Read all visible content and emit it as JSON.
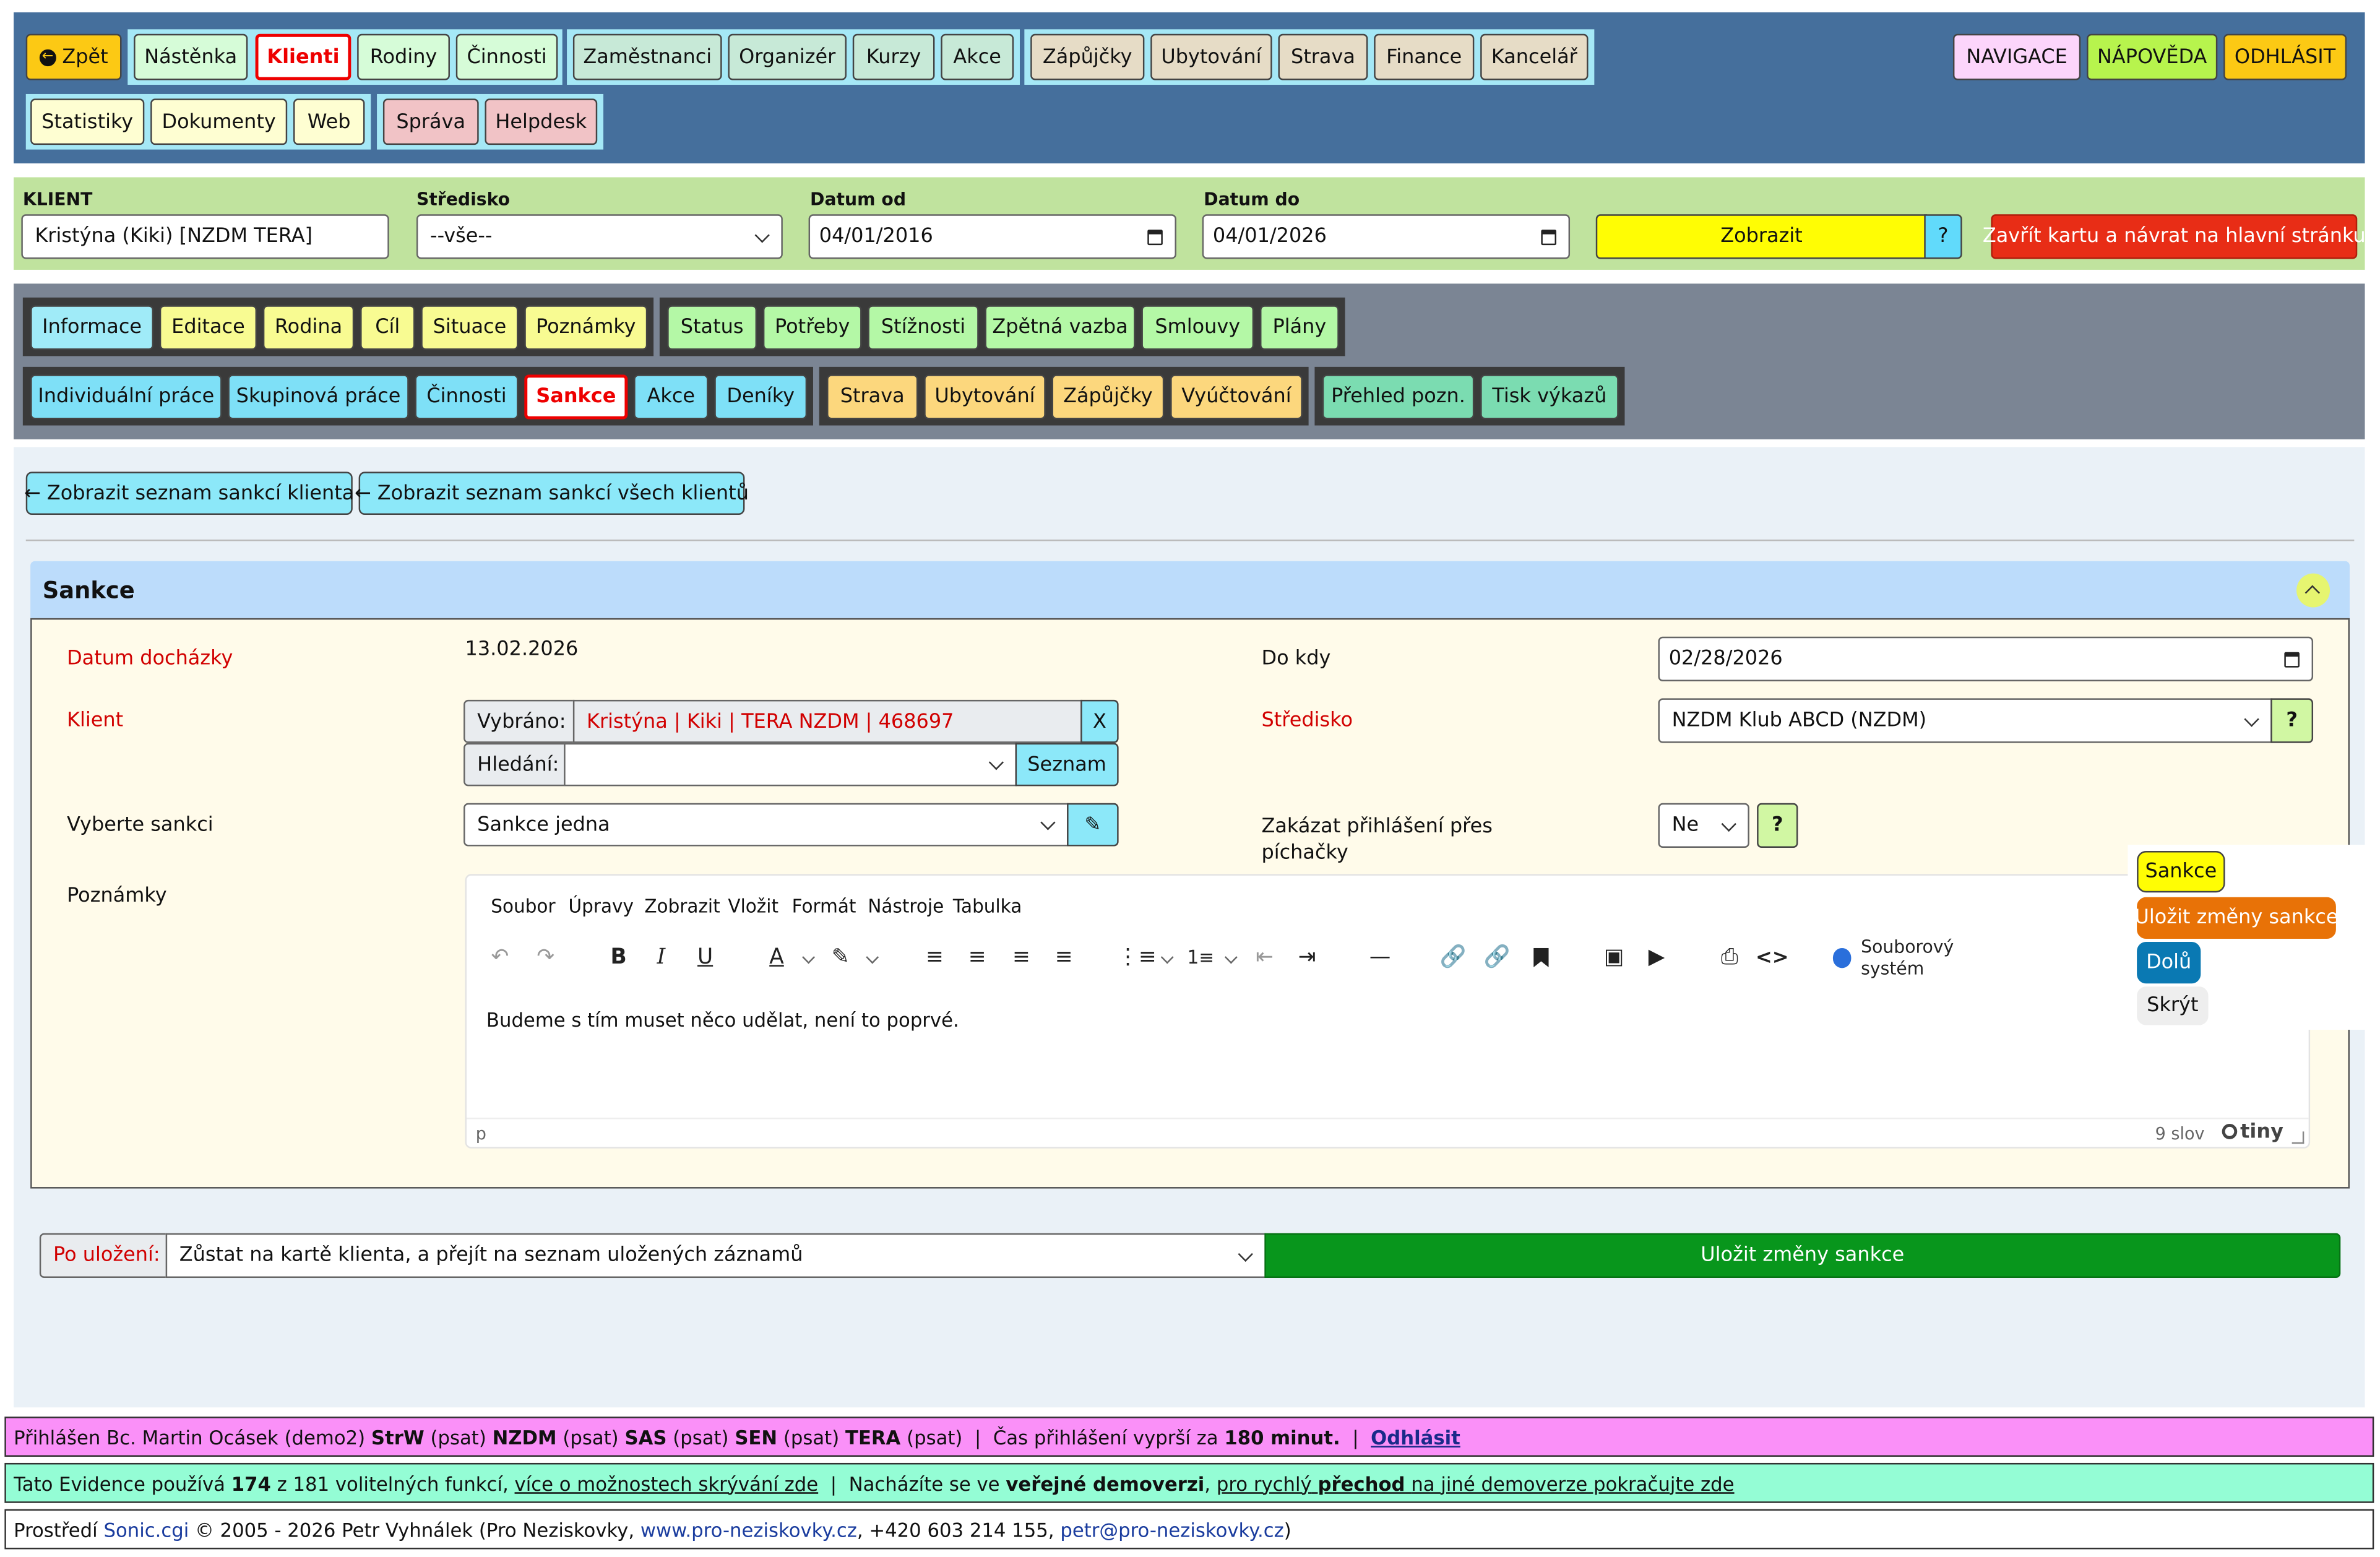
{
  "colors": {
    "topnav_bg": "#456f9c",
    "filter_bg": "#c0e39e",
    "tabs_bg": "#7b8594",
    "section_header": "#bcdcfb",
    "form_bg": "#fffbea",
    "save_green": "#08961c",
    "footer_user": "#fa90f8",
    "footer_info": "#94fdd5"
  },
  "topnav": {
    "back": "Zpět",
    "items": [
      "Nástěnka",
      "Klienti",
      "Rodiny",
      "Činnosti",
      "Zaměstnanci",
      "Organizér",
      "Kurzy",
      "Akce",
      "Zápůjčky",
      "Ubytování",
      "Strava",
      "Finance",
      "Kancelář",
      "Statistiky",
      "Dokumenty",
      "Web",
      "Správa",
      "Helpdesk"
    ],
    "right": [
      "NAVIGACE",
      "NÁPOVĚDA",
      "ODHLÁSIT"
    ]
  },
  "filter": {
    "klient_label": "KLIENT",
    "klient_value": "Kristýna (Kiki) [NZDM TERA]",
    "stredisko_label": "Středisko",
    "stredisko_value": "--vše--",
    "datum_od_label": "Datum od",
    "datum_od_value": "04/01/2016",
    "datum_do_label": "Datum do",
    "datum_do_value": "04/01/2026",
    "zobrazit": "Zobrazit",
    "help": "?",
    "zavrit": "Zavřít kartu a návrat na hlavní stránku"
  },
  "tabs": {
    "row1": [
      "Informace",
      "Editace",
      "Rodina",
      "Cíl",
      "Situace",
      "Poznámky",
      "Status",
      "Potřeby",
      "Stížnosti",
      "Zpětná vazba",
      "Smlouvy",
      "Plány"
    ],
    "row2": [
      "Individuální práce",
      "Skupinová práce",
      "Činnosti",
      "Sankce",
      "Akce",
      "Deníky",
      "Strava",
      "Ubytování",
      "Zápůjčky",
      "Vyúčtování",
      "Přehled pozn.",
      "Tisk výkazů"
    ]
  },
  "links": {
    "client_list": "Zobrazit seznam sankcí klienta",
    "all_list": "Zobrazit seznam sankcí všech klientů"
  },
  "section": {
    "title": "Sankce"
  },
  "form": {
    "datum_label": "Datum docházky",
    "datum_value": "13.02.2026",
    "dokdy_label": "Do kdy",
    "dokdy_value": "02/28/2026",
    "klient_label": "Klient",
    "vybrano_label": "Vybráno:",
    "vybrano_value": "Kristýna | Kiki | TERA NZDM | 468697",
    "clear": "X",
    "hledani_label": "Hledání:",
    "hledani_value": "",
    "seznam": "Seznam",
    "stredisko_label": "Středisko",
    "stredisko_value": "NZDM Klub ABCD (NZDM)",
    "help": "?",
    "sankce_label": "Vyberte sankci",
    "sankce_value": "Sankce jedna",
    "zakazat_label": "Zakázat přihlášení přes píchačky",
    "zakazat_value": "Ne",
    "poznamky_label": "Poznámky"
  },
  "editor": {
    "menu": [
      "Soubor",
      "Úpravy",
      "Zobrazit",
      "Vložit",
      "Formát",
      "Nástroje",
      "Tabulka"
    ],
    "filesystem": "Souborový systém",
    "content": "Budeme s tím muset něco udělat, není to poprvé.",
    "path": "p",
    "words": "9 slov",
    "brand": "tiny"
  },
  "floating": {
    "sankce": "Sankce",
    "ulozit": "Uložit změny sankce",
    "dolu": "Dolů",
    "skryt": "Skrýt"
  },
  "save": {
    "po_ulozeni": "Po uložení:",
    "option": "Zůstat na kartě klienta, a přejít na seznam uložených záznamů",
    "button": "Uložit změny sankce"
  },
  "footer": {
    "user": {
      "prefix": "Přihlášen Bc. Martin Ocásek (demo2)",
      "r1": "StrW",
      "p1": "(psat)",
      "r2": "NZDM",
      "p2": "(psat)",
      "r3": "SAS",
      "p3": "(psat)",
      "r4": "SEN",
      "p4": "(psat)",
      "r5": "TERA",
      "p5": "(psat)",
      "sep": "|",
      "expire": "Čas přihlášení vyprší za",
      "minutes": "180 minut.",
      "logout": "Odhlásit"
    },
    "info": {
      "t1": "Tato Evidence používá",
      "count": "174",
      "t2": "z 181 volitelných funkcí,",
      "link1": "více o možnostech skrývání zde",
      "sep": "|",
      "t3": "Nacházíte se ve",
      "bold1": "veřejné demoverzi",
      "t4": ",",
      "link2a": "pro rychlý",
      "link2b": "přechod",
      "link2c": "na jiné demoverze pokračujte zde"
    },
    "copy": {
      "t1": "Prostředí",
      "sonic": "Sonic.cgi",
      "t2": "© 2005 - 2026 Petr Vyhnálek (Pro Neziskovky,",
      "web": "www.pro-neziskovky.cz",
      "t3": ", +420 603 214 155,",
      "email": "petr@pro-neziskovky.cz",
      "t4": ")"
    }
  }
}
